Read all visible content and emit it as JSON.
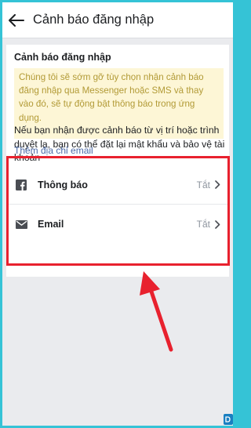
{
  "header": {
    "title": "Cảnh báo đăng nhập"
  },
  "section": {
    "title": "Cảnh báo đăng nhập",
    "notice_lines": [
      "Chúng tôi sẽ sớm gỡ tùy chọn nhận cảnh báo",
      "đăng nhập qua Messenger hoặc SMS và thay",
      "vào đó, sẽ tự động bật thông báo trong ứng",
      "dụng."
    ],
    "description_lines": [
      "Nếu bạn nhận được cảnh báo từ vị trí hoặc trình",
      "duyệt lạ, bạn có thể đặt lại mật khẩu và bảo vệ tài",
      "khoản"
    ],
    "add_email_link": "Thêm địa chỉ email"
  },
  "options": [
    {
      "label": "Thông báo",
      "value": "Tắt",
      "icon": "facebook-icon"
    },
    {
      "label": "Email",
      "value": "Tắt",
      "icon": "mail-icon"
    }
  ],
  "colors": {
    "highlight": "#e8212e",
    "notice_bg": "#fdf6d6",
    "link": "#4b6aa8",
    "frame": "#35c3d6"
  }
}
